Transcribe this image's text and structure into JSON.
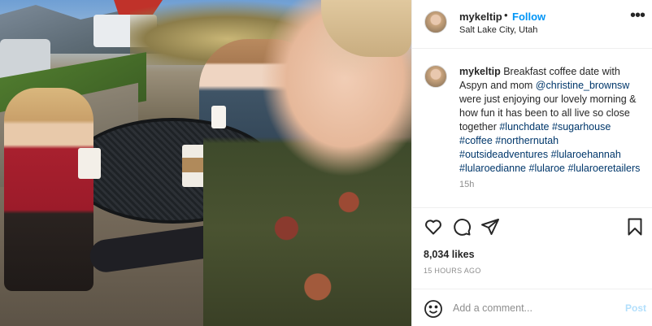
{
  "post": {
    "username": "mykeltip",
    "separator": "•",
    "follow_label": "Follow",
    "location": "Salt Lake City, Utah",
    "more_icon": "more-horizontal-icon"
  },
  "caption": {
    "username": "mykeltip",
    "text_1": " Breakfast coffee date with Aspyn and mom ",
    "mention": "@christine_brownsw",
    "text_2": " were just enjoying our lovely morning & how fun it has been to all live so close together ",
    "hashtags": [
      "#lunchdate",
      "#sugarhouse",
      "#coffee",
      "#northernutah",
      "#outsideadventures",
      "#lularoehannah",
      "#lularoedianne",
      "#lularoe",
      "#lularoeretailers"
    ],
    "time": "15h"
  },
  "actions": {
    "like_icon": "heart-icon",
    "comment_icon": "comment-bubble-icon",
    "share_icon": "paper-plane-icon",
    "save_icon": "bookmark-icon"
  },
  "likes": "8,034 likes",
  "posted_ago": "15 HOURS AGO",
  "comment": {
    "placeholder": "Add a comment...",
    "post_label": "Post",
    "emoji_icon": "smiley-icon"
  },
  "colors": {
    "link_blue": "#0095f6",
    "hashtag": "#00376b",
    "post_disabled": "#b2dffc",
    "secondary_text": "#8e8e8e"
  }
}
